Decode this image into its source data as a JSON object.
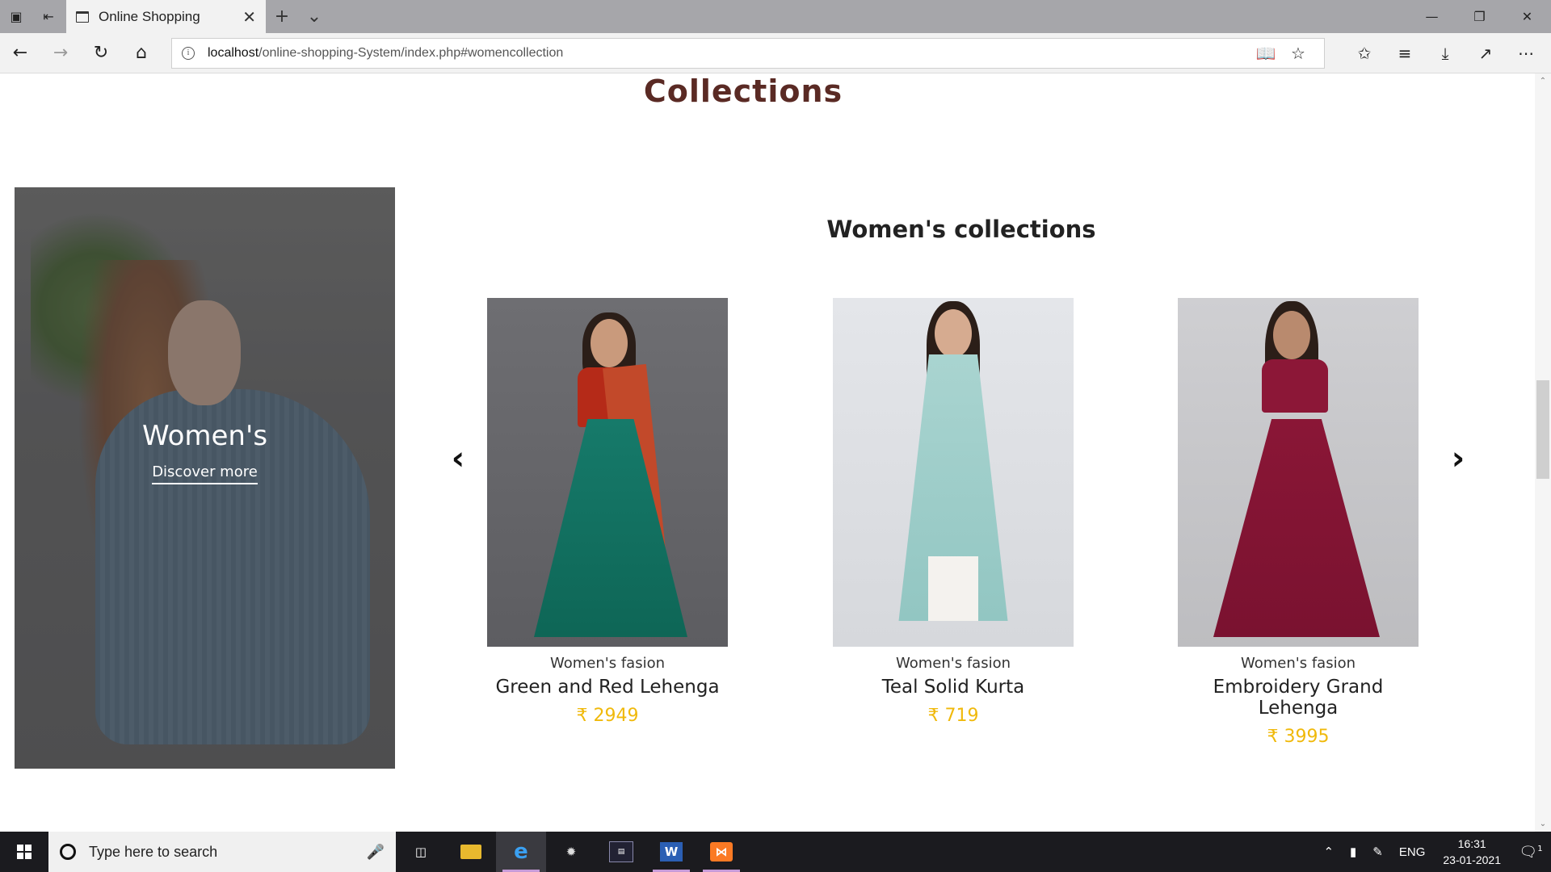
{
  "browser": {
    "tab_title": "Online Shopping",
    "url_host": "localhost",
    "url_path": "/online-shopping-System/index.php#womencollection",
    "info_glyph": "i"
  },
  "page": {
    "collections_heading": "Collections",
    "feature": {
      "title": "Women's",
      "link": "Discover more"
    },
    "section_heading": "Women's collections",
    "products": [
      {
        "category": "Women's fasion",
        "name": "Green and Red Lehenga",
        "price": "₹ 2949"
      },
      {
        "category": "Women's fasion",
        "name": "Teal Solid Kurta",
        "price": "₹ 719"
      },
      {
        "category": "Women's fasion",
        "name": "Embroidery Grand Lehenga",
        "price": "₹ 3995"
      }
    ],
    "price_color": "#f0b90b",
    "heading_color": "#5a2a24"
  },
  "taskbar": {
    "search_placeholder": "Type here to search",
    "language": "ENG",
    "time": "16:31",
    "date": "23-01-2021",
    "notification_count": "1"
  }
}
